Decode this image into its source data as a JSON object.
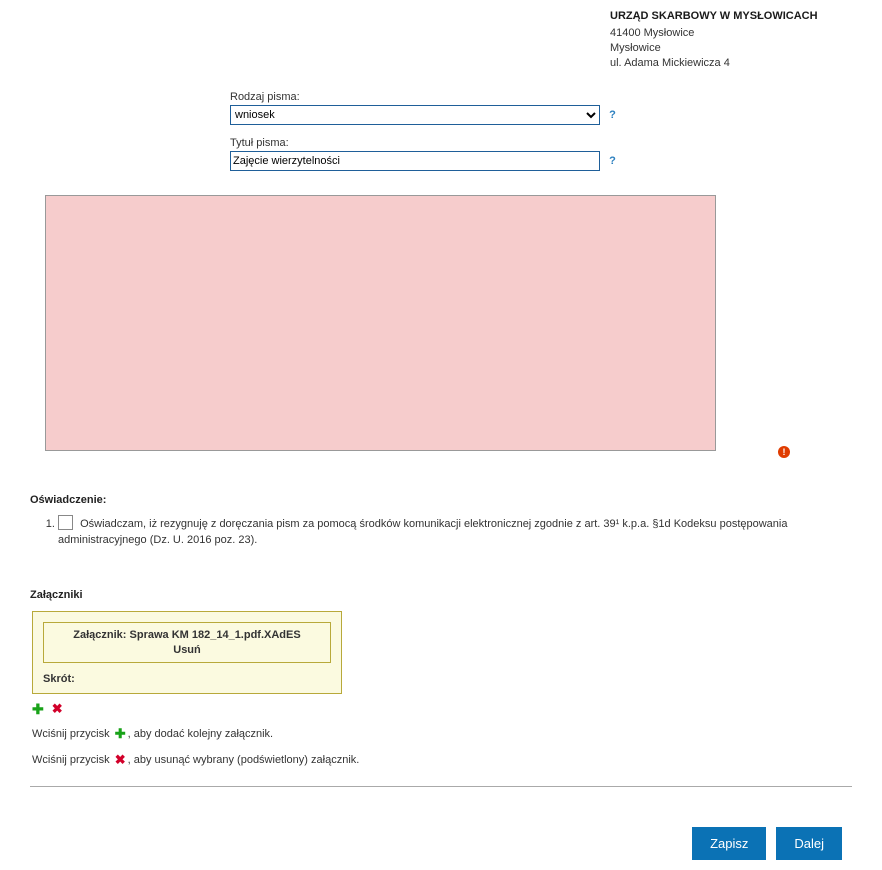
{
  "header": {
    "title": "URZĄD SKARBOWY W MYSŁOWICACH",
    "line1": "41400 Mysłowice",
    "line2": "Mysłowice",
    "line3": "ul. Adama Mickiewicza 4"
  },
  "fields": {
    "rodzaj_label": "Rodzaj pisma:",
    "rodzaj_value": "wniosek",
    "tytul_label": "Tytuł pisma:",
    "tytul_value": "Zajęcie wierzytelności"
  },
  "editor": {
    "value": ""
  },
  "oswiadczenie": {
    "heading": "Oświadczenie:",
    "item_text": "Oświadczam, iż rezygnuję z doręczania pism za pomocą środków komunikacji elektronicznej zgodnie z art. 39¹ k.p.a. §1d Kodeksu postępowania administracyjnego (Dz. U. 2016 poz. 23)."
  },
  "zalaczniki": {
    "heading": "Załączniki",
    "item_label": "Załącznik: Sprawa KM 182_14_1.pdf.XAdES",
    "delete_label": "Usuń",
    "skrot_label": "Skrót:"
  },
  "hints": {
    "add_pre": "Wciśnij przycisk",
    "add_post": ", aby dodać kolejny załącznik.",
    "del_pre": "Wciśnij przycisk",
    "del_post": ", aby usunąć wybrany (podświetlony) załącznik."
  },
  "buttons": {
    "save": "Zapisz",
    "next": "Dalej"
  }
}
